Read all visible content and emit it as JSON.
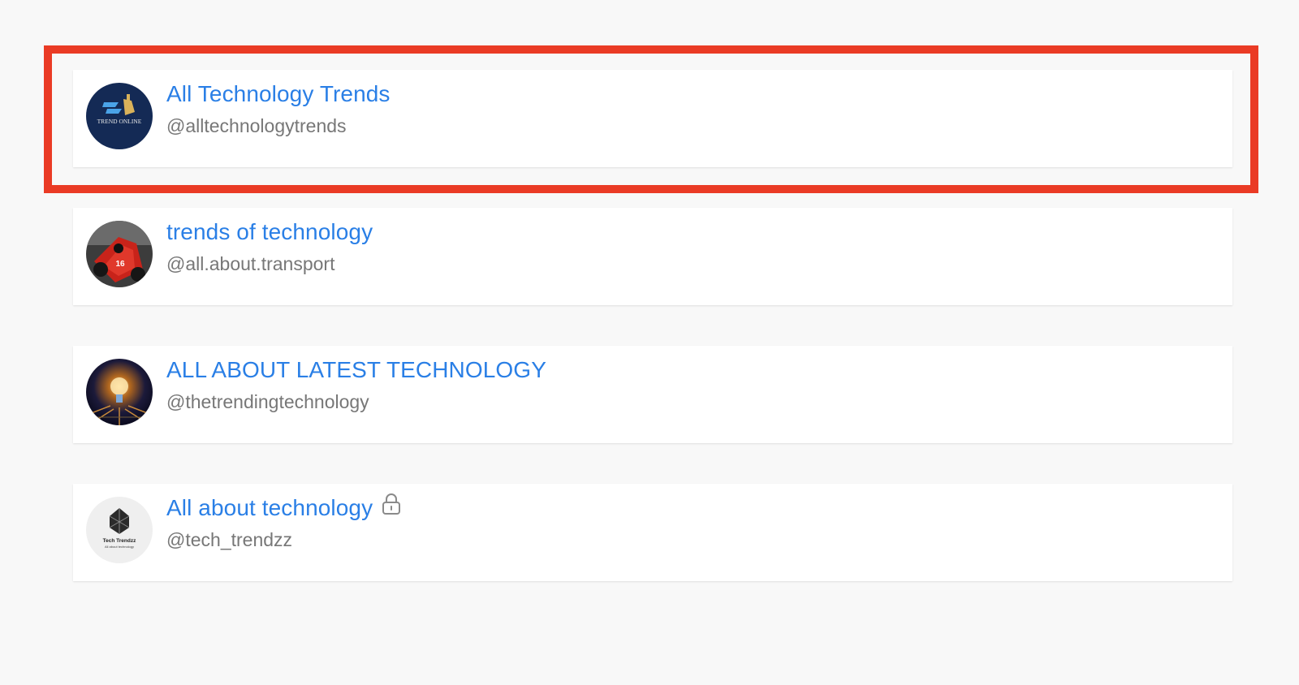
{
  "accounts": [
    {
      "name": "All Technology Trends",
      "handle": "@alltechnologytrends",
      "avatar_icon": "trend-online-logo",
      "locked": false,
      "avatar_text": "TREND ONLINE"
    },
    {
      "name": "trends of technology",
      "handle": "@all.about.transport",
      "avatar_icon": "race-car-photo",
      "locked": false,
      "avatar_text": "16"
    },
    {
      "name": "ALL ABOUT LATEST TECHNOLOGY",
      "handle": "@thetrendingtechnology",
      "avatar_icon": "lightbulb-circuit-photo",
      "locked": false
    },
    {
      "name": "All about technology",
      "handle": "@tech_trendzz",
      "avatar_icon": "tech-trendzz-logo",
      "locked": true,
      "avatar_text": "Tech Trendzz",
      "avatar_subtext": "All about technology"
    }
  ],
  "colors": {
    "name": "#2a7fe6",
    "handle": "#777777",
    "background": "#f8f8f8",
    "card": "#ffffff",
    "highlight": "#ea3b25"
  }
}
